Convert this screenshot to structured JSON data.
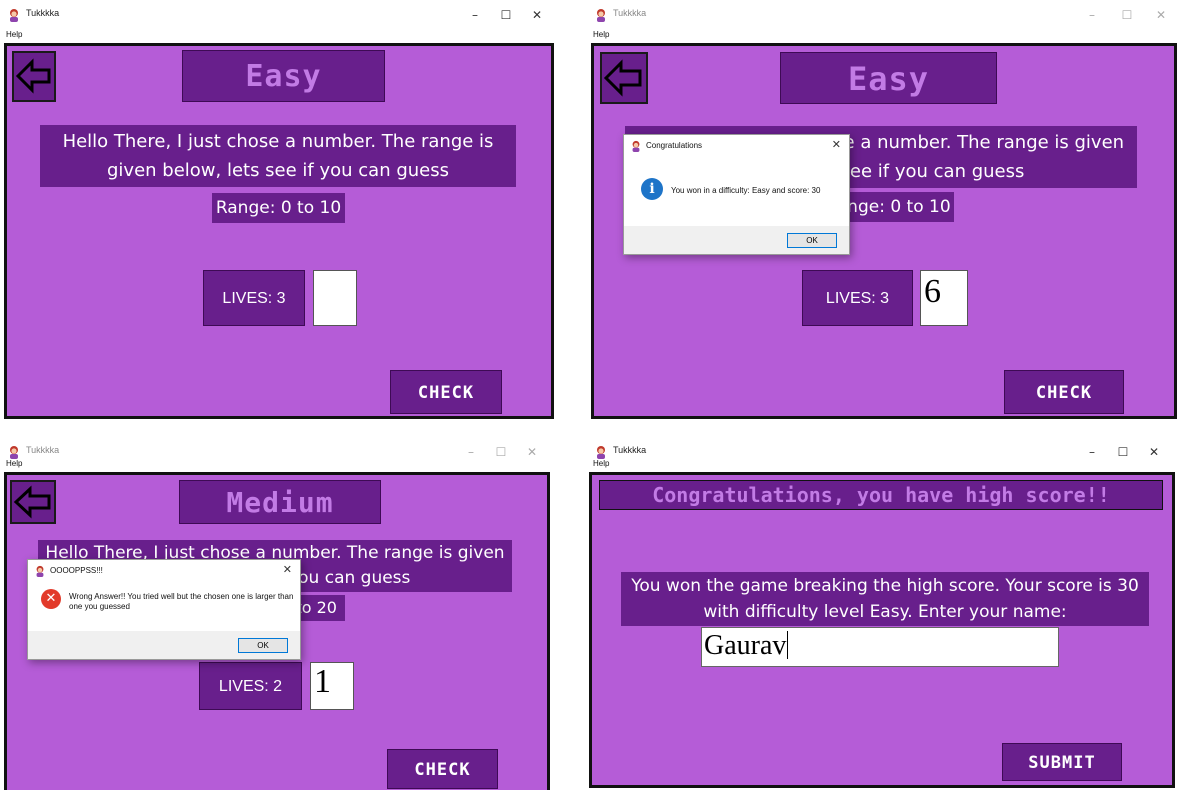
{
  "app": {
    "title": "Tukkkka",
    "menu_help": "Help",
    "win_minimize": "–",
    "win_maximize": "☐",
    "win_close": "✕"
  },
  "colors": {
    "background": "#b55cd7",
    "panel": "#681f8c",
    "title_text": "#c27be5"
  },
  "icons": {
    "back": "back-arrow-icon",
    "app": "app-avatar-icon",
    "info": "info-icon",
    "error": "error-icon"
  },
  "screen1": {
    "level": "Easy",
    "message": "Hello There, I just chose a number. The range is given below, lets see if you can guess",
    "range": "Range:  0 to 10",
    "lives": "LIVES: 3",
    "guess": "",
    "check": "CHECK"
  },
  "screen2": {
    "level": "Easy",
    "message_visible": "Hello There, I just chose a number. The range is given below, lets see if you can guess",
    "range": "Range:  0 to 10",
    "lives": "LIVES: 3",
    "guess": "6",
    "check": "CHECK",
    "dialog": {
      "title": "Congratulations",
      "text": "You won in a difficulty: Easy and score: 30",
      "ok": "OK",
      "close": "✕"
    }
  },
  "screen3": {
    "level": "Medium",
    "message": "Hello There, I just chose a number. The range is given below, lets see if you can guess",
    "range": "Range:  0 to 20",
    "lives": "LIVES: 2",
    "guess": "1",
    "check": "CHECK",
    "dialog": {
      "title": "OOOOPPSS!!!",
      "text": "Wrong Answer!! You tried well but the chosen one is larger than one you guessed",
      "ok": "OK",
      "close": "✕"
    }
  },
  "screen4": {
    "header": "Congratulations, you have high score!!",
    "message": "You won the game breaking the high score. Your score is 30 with difficulty level Easy. Enter your name:",
    "name_value": "Gaurav",
    "submit": "SUBMIT"
  }
}
